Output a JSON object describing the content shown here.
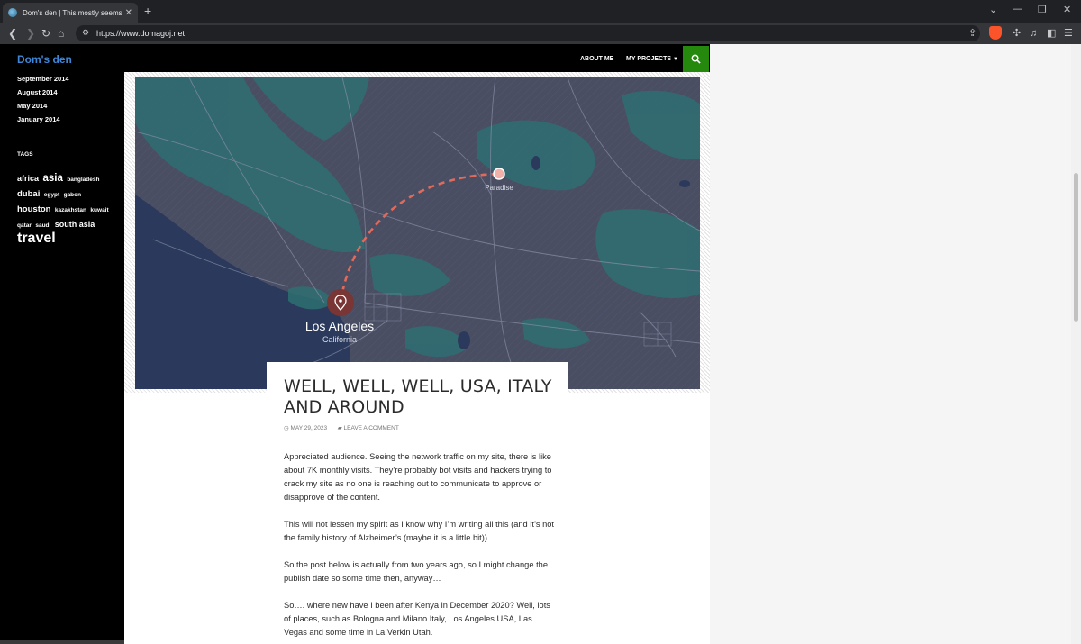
{
  "browser": {
    "tab_title": "Dom's den | This mostly seems t",
    "url": "https://www.domagoj.net"
  },
  "sidebar": {
    "site_title": "Dom's den",
    "archive": [
      "September 2014",
      "August 2014",
      "May 2014",
      "January 2014"
    ],
    "tags_heading": "TAGS",
    "tags": [
      {
        "label": "africa",
        "size": 9
      },
      {
        "label": "asia",
        "size": 11.5
      },
      {
        "label": "bangladesh",
        "size": 6.5
      },
      {
        "label": "dubai",
        "size": 9.5
      },
      {
        "label": "egypt",
        "size": 6.5
      },
      {
        "label": "gabon",
        "size": 6.5
      },
      {
        "label": "houston",
        "size": 9.5
      },
      {
        "label": "kazakhstan",
        "size": 6.5
      },
      {
        "label": "kuwait",
        "size": 6.5
      },
      {
        "label": "qatar",
        "size": 6.5
      },
      {
        "label": "saudi",
        "size": 6.5
      },
      {
        "label": "south asia",
        "size": 9
      },
      {
        "label": "travel",
        "size": 16
      }
    ]
  },
  "header": {
    "nav_about": "ABOUT ME",
    "nav_projects": "MY PROJECTS"
  },
  "map": {
    "origin_label": "Los Angeles",
    "origin_sublabel": "California",
    "destination_label": "Paradise"
  },
  "post": {
    "title": "WELL, WELL, WELL, USA, ITALY AND AROUND",
    "date": "MAY 29, 2023",
    "comment_link": "LEAVE A COMMENT",
    "paragraphs": [
      "Appreciated audience. Seeing the network traffic on my site, there is like about 7K monthly visits. They’re probably bot visits and hackers trying to crack my site as no one is reaching out to communicate to approve or disapprove of the content.",
      "This will not lessen my spirit as I know why I’m writing all this (and it’s not the family history of Alzheimer’s (maybe it is a little bit)).",
      "So the post below is actually from two years ago, so I might change the publish date so some time then, anyway…",
      "So…. where new have I been after Kenya in December 2020? Well, lots of places, such as Bologna and Milano Italy, Los Angeles USA, Las Vegas and some time in La Verkin Utah."
    ]
  }
}
